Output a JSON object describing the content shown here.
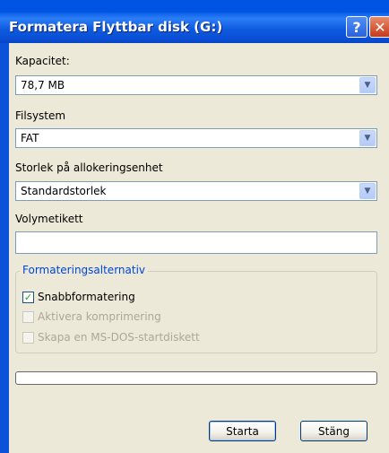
{
  "window": {
    "title": "Formatera Flyttbar disk (G:)",
    "help_glyph": "?",
    "close_glyph": "✕"
  },
  "capacity": {
    "label": "Kapacitet:",
    "value": "78,7 MB"
  },
  "filesystem": {
    "label": "Filsystem",
    "value": "FAT"
  },
  "allocation": {
    "label": "Storlek på allokeringsenhet",
    "value": "Standardstorlek"
  },
  "volume": {
    "label": "Volymetikett",
    "value": ""
  },
  "options": {
    "title": "Formateringsalternativ",
    "items": [
      {
        "label": "Snabbformatering",
        "checked": true,
        "enabled": true
      },
      {
        "label": "Aktivera komprimering",
        "checked": false,
        "enabled": false
      },
      {
        "label": "Skapa en MS-DOS-startdiskett",
        "checked": false,
        "enabled": false
      }
    ]
  },
  "progress": {
    "fraction": 0
  },
  "buttons": {
    "start": "Starta",
    "close": "Stäng"
  },
  "check_glyph": "✓",
  "dropdown_glyph": "▼",
  "colors": {
    "titlebar": "#0a5fe8",
    "dialog_bg": "#ece9d8",
    "group_title": "#0046d5"
  }
}
